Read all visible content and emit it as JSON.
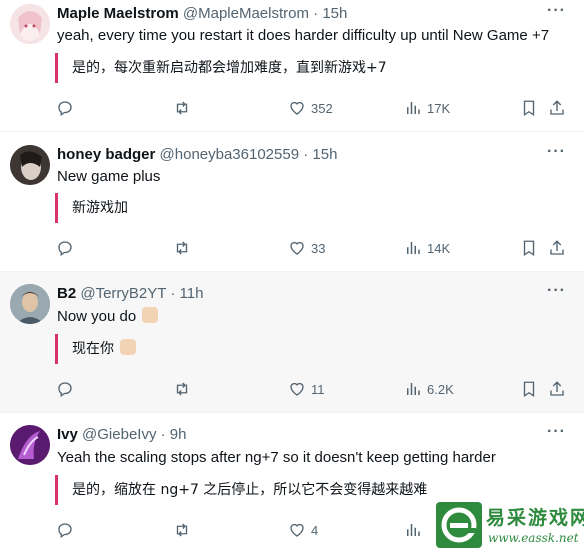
{
  "tweets": [
    {
      "name": "Maple Maelstrom",
      "handle": "@MapleMaelstrom",
      "sep": "·",
      "time": "15h",
      "text": "yeah, every time you restart it does harder difficulty up until New Game +7",
      "translation": "是的，每次重新启动都会增加难度，直到新游戏+7",
      "likes": "352",
      "views": "17K",
      "replies": "",
      "reposts": "",
      "avatar_color": "#f3d6dc"
    },
    {
      "name": "honey badger",
      "handle": "@honeyba36102559",
      "sep": "·",
      "time": "15h",
      "text": "New game plus",
      "translation": "新游戏加",
      "likes": "33",
      "views": "14K",
      "replies": "",
      "reposts": "",
      "avatar_color": "#5a4f4a"
    },
    {
      "name": "B2",
      "handle": "@TerryB2YT",
      "sep": "·",
      "time": "11h",
      "text": "Now you do",
      "translation": "现在你",
      "likes": "11",
      "views": "6.2K",
      "replies": "",
      "reposts": "",
      "avatar_color": "#7a8a96"
    },
    {
      "name": "Ivy",
      "handle": "@GiebeIvy",
      "sep": "·",
      "time": "9h",
      "text": "Yeah the scaling stops after ng+7 so it doesn't keep getting harder",
      "translation": "是的，缩放在 ng+7 之后停止，所以它不会变得越来越难",
      "likes": "4",
      "views": "",
      "replies": "",
      "reposts": "",
      "avatar_color": "#7b2a8f"
    }
  ],
  "more_glyph": "···",
  "watermark": {
    "cn": "易采游戏网",
    "url": "www.eassk.net"
  },
  "colors": {
    "accent_bar": "#d6336c",
    "muted": "#536471",
    "watermark_green": "#2e8b3e"
  }
}
